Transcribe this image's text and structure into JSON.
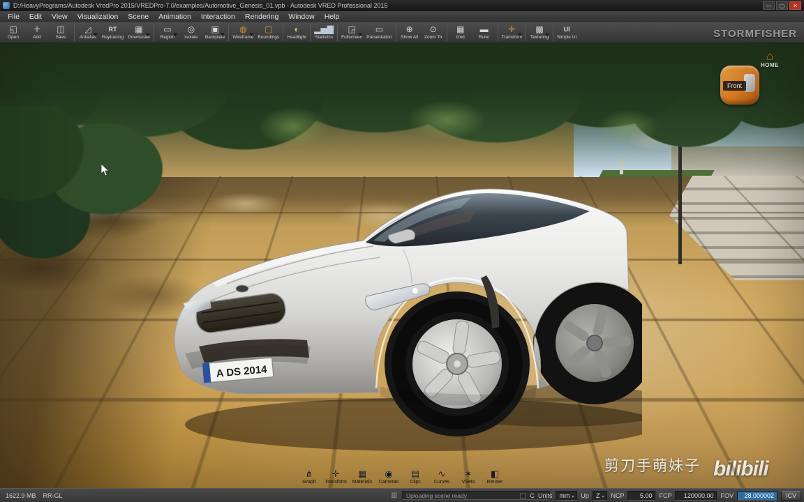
{
  "window": {
    "title": "D:/HeavyPrograms/Autodesk VredPro 2015/VREDPro-7.0/examples/Automotive_Genesis_01.vpb - Autodesk VRED Professional 2015",
    "minimize": "—",
    "maximize": "▢",
    "close": "✕"
  },
  "menu": {
    "items": [
      "File",
      "Edit",
      "View",
      "Visualization",
      "Scene",
      "Animation",
      "Interaction",
      "Rendering",
      "Window",
      "Help"
    ]
  },
  "toolbar": {
    "labels": [
      "Open",
      "Add",
      "Save",
      "Antialias",
      "Raytracing",
      "Downscale",
      "Region",
      "Isolate",
      "Backplate",
      "Wireframe",
      "Boundings",
      "Headlight",
      "Statistics",
      "Fullscreen",
      "Presentation",
      "Show All",
      "Zoom To",
      "Grid",
      "Ruler",
      "Transform",
      "Texturing",
      "Simple UI"
    ],
    "icon_text": {
      "raytracing": "RT",
      "simple_ui": "UI"
    },
    "watermark": "STORMFISHER"
  },
  "viewport": {
    "nav": {
      "home": "HOME",
      "face": "Front"
    },
    "plate": "A DS 2014"
  },
  "modules": {
    "items": [
      "Graph",
      "Transform",
      "Materials",
      "Cameras",
      "Clips",
      "Curves",
      "VSets",
      "Render"
    ]
  },
  "overlay": {
    "uploader": "剪刀手萌妹子",
    "site": "bilibili"
  },
  "status": {
    "memory": "1622.9 MB",
    "renderer": "RR-GL",
    "progress": "Uploading scene ready",
    "c": "C",
    "units_label": "Units",
    "units": "mm",
    "up_label": "Up",
    "up": "Z",
    "ncp_label": "NCP",
    "ncp": "5.00",
    "fcp_label": "FCP",
    "fcp": "120000.00",
    "fov_label": "FOV",
    "fov": "28.000002",
    "icv": "ICV"
  },
  "colors": {
    "accent_orange": "#e09232",
    "ui_dark": "#3a3a3a",
    "pavement": "#d2ab62"
  }
}
